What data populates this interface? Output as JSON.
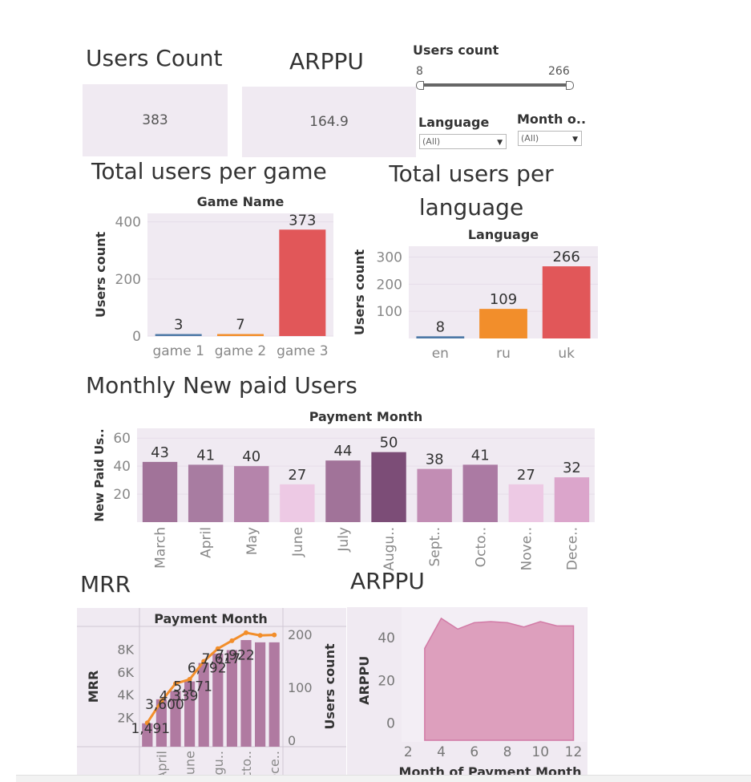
{
  "kpis": {
    "users_count_title": "Users Count",
    "users_count_value": "383",
    "arppu_title": "ARPPU",
    "arppu_value": "164.9"
  },
  "filters": {
    "slider_label": "Users count",
    "slider_min": "8",
    "slider_max": "266",
    "language_label": "Language",
    "language_value": "(All)",
    "month_label": "Month o..",
    "month_value": "(All)"
  },
  "sections": {
    "per_game": "Total users per game",
    "per_language": "Total users per language",
    "monthly": "Monthly New paid Users",
    "mrr": "MRR",
    "arppu": "ARPPU"
  },
  "colors": {
    "blue": "#4e79a7",
    "orange": "#f28e2b",
    "red": "#e15759",
    "panel_bg": "#f0eaf2",
    "mrr_bar": "#b07aa1",
    "area": "#dd9fbd",
    "area_stroke": "#d27aa6"
  },
  "chart_data": [
    {
      "id": "game",
      "type": "bar",
      "header": "Game Name",
      "ylabel": "Users count",
      "ylim": [
        0,
        430
      ],
      "yticks": [
        0,
        200,
        400
      ],
      "categories": [
        "game 1",
        "game 2",
        "game 3"
      ],
      "values": [
        3,
        7,
        373
      ],
      "colors": [
        "#4e79a7",
        "#f28e2b",
        "#e15759"
      ],
      "labels": [
        "3",
        "7",
        "373"
      ]
    },
    {
      "id": "language",
      "type": "bar",
      "header": "Language",
      "ylabel": "Users count",
      "ylim": [
        0,
        340
      ],
      "yticks": [
        100,
        200,
        300
      ],
      "categories": [
        "en",
        "ru",
        "uk"
      ],
      "values": [
        8,
        109,
        266
      ],
      "colors": [
        "#4e79a7",
        "#f28e2b",
        "#e15759"
      ],
      "labels": [
        "8",
        "109",
        "266"
      ]
    },
    {
      "id": "monthly",
      "type": "bar",
      "header": "Payment Month",
      "ylabel": "New Paid Us..",
      "ylim": [
        0,
        67
      ],
      "yticks": [
        20,
        40,
        60
      ],
      "categories": [
        "March",
        "April",
        "May",
        "June",
        "July",
        "Augu..",
        "Sept..",
        "Octo..",
        "Nove..",
        "Dece.."
      ],
      "values": [
        43,
        41,
        40,
        27,
        44,
        50,
        38,
        41,
        27,
        32
      ],
      "colors": [
        "#a17399",
        "#a87ca1",
        "#b584ab",
        "#edc9e4",
        "#a17399",
        "#7c4d77",
        "#c28db4",
        "#ab7aa3",
        "#edc9e4",
        "#dba5cb"
      ],
      "labels": [
        "43",
        "41",
        "40",
        "27",
        "44",
        "50",
        "38",
        "41",
        "27",
        "32"
      ]
    },
    {
      "id": "mrr",
      "type": "bar+line",
      "header": "Payment Month",
      "ylabel": "MRR",
      "y2label": "Users count",
      "ylim": [
        0,
        10000
      ],
      "yticks": [
        2000,
        4000,
        6000,
        8000
      ],
      "yticklabels": [
        "2K",
        "4K",
        "6K",
        "8K"
      ],
      "y2lim": [
        0,
        215
      ],
      "y2ticks": [
        0,
        100,
        200
      ],
      "categories": [
        "April",
        "June",
        "Augu..",
        "Octo..",
        "Dece.."
      ],
      "bars": [
        1491,
        3600,
        4339,
        5171,
        6792,
        7617,
        7922,
        8800,
        8600,
        8600
      ],
      "line": [
        33,
        74,
        107,
        115,
        149,
        173,
        188,
        203,
        198,
        199
      ],
      "labels": [
        {
          "text": "1,491",
          "i": 0
        },
        {
          "text": "3,600",
          "i": 1
        },
        {
          "text": "4,339",
          "i": 2
        },
        {
          "text": "5,171",
          "i": 3
        },
        {
          "text": "6,792",
          "i": 4
        },
        {
          "text": "7,617",
          "i": 5
        },
        {
          "text": "7,922",
          "i": 6
        }
      ]
    },
    {
      "id": "arppu",
      "type": "area",
      "ylabel": "ARPPU",
      "xlabel": "Month of Payment Month",
      "xlim": [
        1.6,
        12.8
      ],
      "ylim": [
        -8,
        55
      ],
      "xticks": [
        2,
        4,
        6,
        8,
        10,
        12
      ],
      "yticks": [
        0,
        20,
        40
      ],
      "x": [
        3,
        4,
        5,
        6,
        7,
        8,
        9,
        10,
        11,
        12
      ],
      "y": [
        35,
        49,
        44,
        47,
        47.5,
        47,
        45,
        47.5,
        45.5,
        45.5
      ]
    }
  ]
}
